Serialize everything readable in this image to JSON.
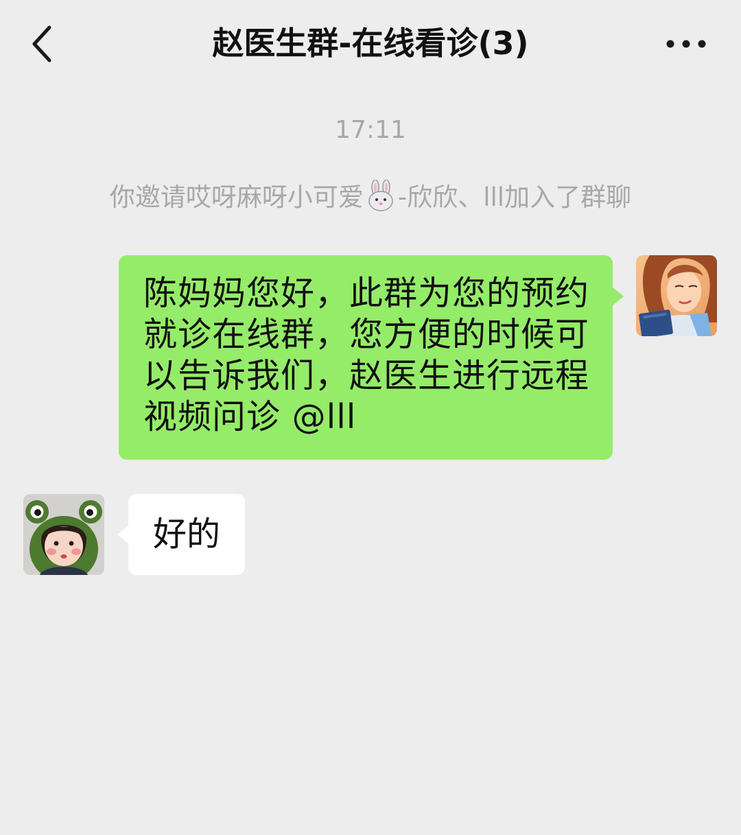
{
  "header": {
    "title": "赵医生群-在线看诊(3)",
    "back_icon": "chevron-left-icon",
    "more_icon": "ellipsis-icon"
  },
  "chat": {
    "timestamp": "17:11",
    "system_message": {
      "prefix": "你邀请哎呀麻呀小可爱",
      "emoji": "rabbit-icon",
      "suffix": "-欣欣、lll加入了群聊"
    },
    "messages": [
      {
        "sender": "self",
        "lines": [
          "陈妈妈您好，此群为您的预约",
          "就诊在线群，您方便的时候可",
          "以告诉我们，赵医生进行远程",
          "视频问诊 @lll"
        ],
        "bubble_color": "#95ec69"
      },
      {
        "sender": "other",
        "text": "好的",
        "bubble_color": "#ffffff"
      }
    ]
  },
  "colors": {
    "background": "#ededed",
    "system_text": "#a8a8a8",
    "self_bubble": "#95ec69",
    "other_bubble": "#ffffff"
  }
}
